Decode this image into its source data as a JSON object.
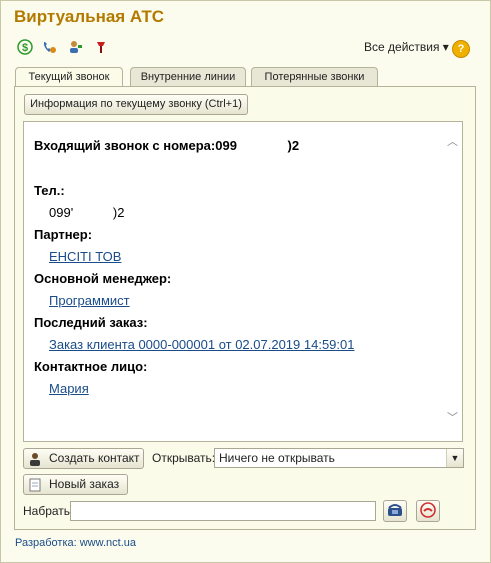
{
  "window": {
    "title": "Виртуальная АТС"
  },
  "toolbar": {
    "icons": [
      "dollar-icon",
      "phone-settings-icon",
      "user-icon",
      "pin-icon"
    ],
    "all_actions": "Все действия ▾",
    "help": "?"
  },
  "tabs": [
    {
      "label": "Текущий звонок",
      "active": true
    },
    {
      "label": "Внутренние линии",
      "active": false
    },
    {
      "label": "Потерянные звонки",
      "active": false
    }
  ],
  "info_button": "Информация по текущему звонку (Ctrl+1)",
  "call": {
    "heading_label": "Входящий звонок с номера:",
    "heading_number": "099              )2",
    "phone_label": "Тел.:",
    "phone_value": "099'           )2",
    "partner_label": "Партнер:",
    "partner_value": "ЕНСІТІ ТОВ",
    "manager_label": "Основной менеджер:",
    "manager_value": "Программист",
    "last_order_label": "Последний заказ:",
    "last_order_value": "Заказ клиента 0000-000001 от 02.07.2019 14:59:01",
    "contact_label": "Контактное лицо:",
    "contact_value": "Мария"
  },
  "actions": {
    "create_contact": "Создать контакт",
    "open_label": "Открывать:",
    "open_value": "Ничего не открывать",
    "new_order": "Новый заказ",
    "dial_label": "Набрать:",
    "dial_value": ""
  },
  "footer": "Разработка: www.nct.ua"
}
